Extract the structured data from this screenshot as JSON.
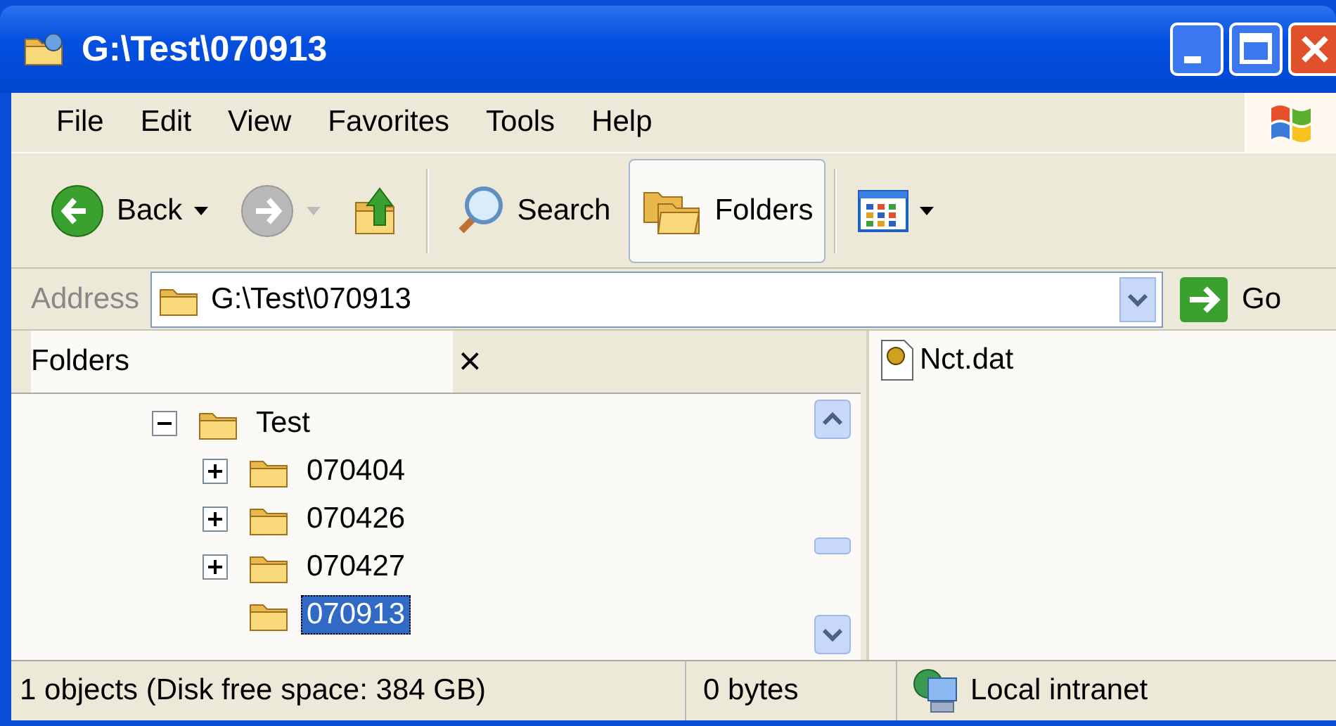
{
  "window": {
    "title": "G:\\Test\\070913"
  },
  "menu": [
    {
      "label": "File"
    },
    {
      "label": "Edit"
    },
    {
      "label": "View"
    },
    {
      "label": "Favorites"
    },
    {
      "label": "Tools"
    },
    {
      "label": "Help"
    }
  ],
  "toolbar": [
    {
      "kind": "back",
      "label": "Back",
      "disabled": false,
      "selected": false
    },
    {
      "kind": "forward",
      "disabled": true,
      "selected": false
    },
    {
      "kind": "up",
      "selected": false
    },
    {
      "kind": "separator"
    },
    {
      "kind": "search",
      "label": "Search",
      "selected": false
    },
    {
      "kind": "folders",
      "label": "Folders",
      "selected": true
    },
    {
      "kind": "separator"
    },
    {
      "kind": "views",
      "selected": false
    }
  ],
  "address": {
    "label": "Address",
    "value": "G:\\Test\\070913",
    "go": "Go"
  },
  "folders_pane": {
    "title": "Folders",
    "close": "×",
    "tree": [
      {
        "label": "Test",
        "expanded": true,
        "selected": false,
        "children": [
          {
            "label": "070404",
            "expanded": false,
            "selected": false
          },
          {
            "label": "070426",
            "expanded": false,
            "selected": false
          },
          {
            "label": "070427",
            "expanded": false,
            "selected": false
          },
          {
            "label": "070913",
            "selected": true
          }
        ]
      }
    ]
  },
  "files": [
    {
      "name": "Nct.dat"
    }
  ],
  "status_bar": {
    "objects": "1 objects (Disk free space: 384 GB)",
    "size": "0 bytes",
    "zone": "Local intranet"
  }
}
